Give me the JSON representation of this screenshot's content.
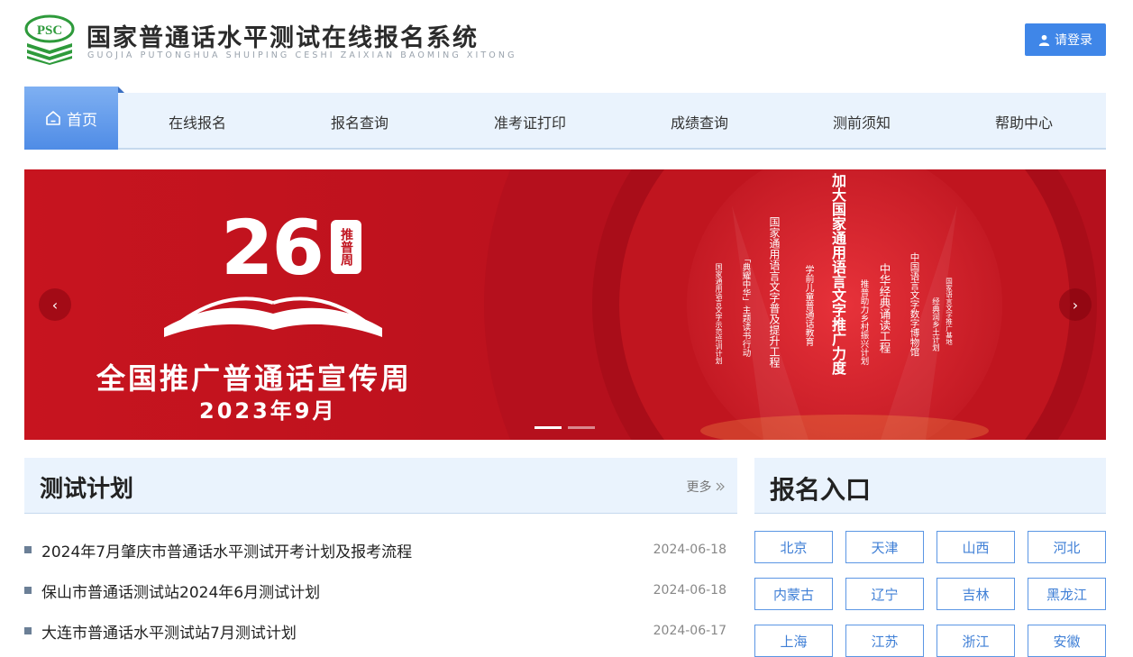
{
  "header": {
    "logo_text": "PSC",
    "title": "国家普通话水平测试在线报名系统",
    "pinyin": "GUOJIA PUTONGHUA SHUIPING CESHI ZAIXIAN BAOMING XITONG",
    "login_label": "请登录"
  },
  "nav": {
    "home_label": "首页",
    "items": [
      "在线报名",
      "报名查询",
      "准考证打印",
      "成绩查询",
      "测前须知",
      "帮助中心"
    ]
  },
  "banner": {
    "number": "26",
    "seal_text": "推普周",
    "title": "全国推广普通话宣传周",
    "date": "2023年9月",
    "center_text": "加大国家通用语言文字推广力度",
    "side_texts": [
      "国家通用语言文字示范培训计划",
      "「典耀中华」主题读书行动",
      "国家通用语言文字普及提升工程",
      "学前儿童普通话教育",
      "推普助力乡村振兴计划",
      "中华经典诵读工程",
      "中国语言文字数字博物馆",
      "经典润乡土计划",
      "国家语言文字推广基地"
    ],
    "prev_icon": "‹",
    "next_icon": "›"
  },
  "plan": {
    "title": "测试计划",
    "more": "更多",
    "items": [
      {
        "text": "2024年7月肇庆市普通话水平测试开考计划及报考流程",
        "date": "2024-06-18"
      },
      {
        "text": "保山市普通话测试站2024年6月测试计划",
        "date": "2024-06-18"
      },
      {
        "text": "大连市普通话水平测试站7月测试计划",
        "date": "2024-06-17"
      }
    ]
  },
  "register": {
    "title": "报名入口",
    "provinces": [
      "北京",
      "天津",
      "山西",
      "河北",
      "内蒙古",
      "辽宁",
      "吉林",
      "黑龙江",
      "上海",
      "江苏",
      "浙江",
      "安徽"
    ]
  },
  "colors": {
    "accent": "#3f86e8",
    "nav_bg": "#eaf3fd",
    "banner_red": "#c0141f",
    "logo_green": "#2e9a3b"
  }
}
